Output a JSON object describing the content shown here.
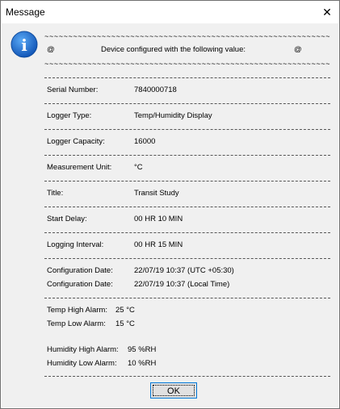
{
  "window": {
    "title": "Message",
    "close_glyph": "✕"
  },
  "icon": {
    "name": "info-icon",
    "glyph": "i",
    "color": "#1c6fd6"
  },
  "message": {
    "tilde_line": "~~~~~~~~~~~~~~~~~~~~~~~~~~~~~~~~~~~~~~~~~~~~~~~~~~~~~~~~~~~~",
    "at_left": "@",
    "heading": "Device configured with the following value:",
    "at_right": "@",
    "serial_label": "Serial Number:",
    "serial_value": "7840000718",
    "logger_type_label": "Logger Type:",
    "logger_type_value": "Temp/Humidity Display",
    "capacity_label": "Logger Capacity:",
    "capacity_value": "16000",
    "unit_label": "Measurement Unit:",
    "unit_value": "°C",
    "title_label": "Title:",
    "title_value": "Transit Study",
    "start_delay_label": "Start Delay:",
    "start_delay_value": "00 HR 10 MIN",
    "interval_label": "Logging Interval:",
    "interval_value": "00 HR 15 MIN",
    "config_date_label_1": "Configuration Date:",
    "config_date_value_1": "22/07/19 10:37 (UTC +05:30)",
    "config_date_label_2": "Configuration Date:",
    "config_date_value_2": "22/07/19 10:37 (Local Time)",
    "temp_high_label": "Temp High Alarm:",
    "temp_high_value": "25 °C",
    "temp_low_label": "Temp Low Alarm:",
    "temp_low_value": "15 °C",
    "hum_high_label": "Humidity High Alarm:",
    "hum_high_value": "95 %RH",
    "hum_low_label": "Humidity Low Alarm:",
    "hum_low_value": "10 %RH"
  },
  "buttons": {
    "ok_label": "OK"
  }
}
